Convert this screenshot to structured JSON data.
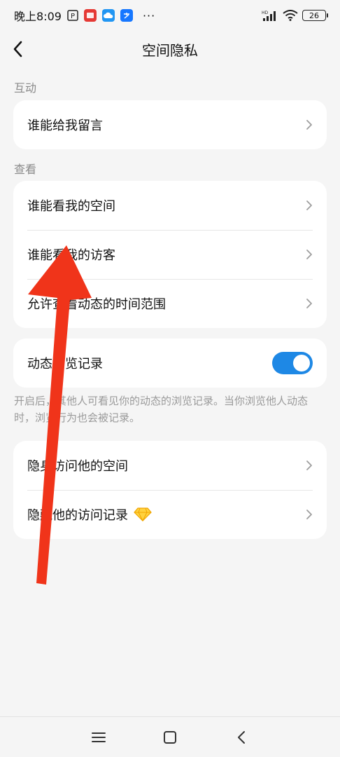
{
  "status": {
    "time": "晚上8:09",
    "dots": "···",
    "network": "HD",
    "battery": "26"
  },
  "nav": {
    "title": "空间隐私"
  },
  "sections": {
    "interaction_label": "互动",
    "view_label": "查看"
  },
  "rows": {
    "who_can_comment": "谁能给我留言",
    "who_can_view_space": "谁能看我的空间",
    "who_can_view_visitors": "谁能看我的访客",
    "allow_view_time_range": "允许查看动态的时间范围",
    "browse_records": "动态浏览记录",
    "hide_visit_space": "隐身访问他的空间",
    "hide_visit_records": "隐藏他的访问记录"
  },
  "toggle": {
    "browse_records_on": true,
    "accent": "#1e88e5"
  },
  "note": "开启后，其他人可看见你的动态的浏览记录。当你浏览他人动态时，浏览行为也会被记录。",
  "overlay": {
    "arrow_color": "#f0341a"
  }
}
